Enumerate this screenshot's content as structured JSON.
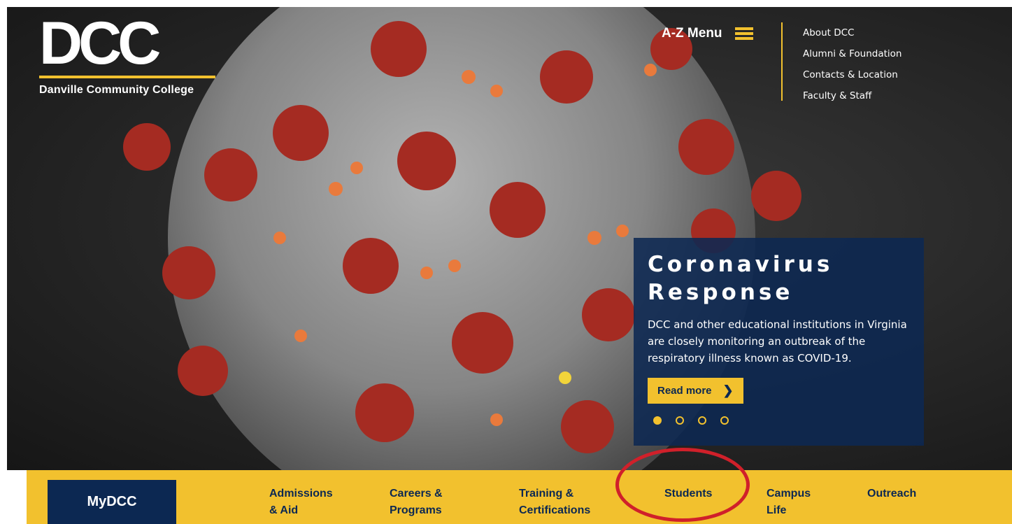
{
  "logo": {
    "mark": "DCC",
    "name": "Danville Community College"
  },
  "header": {
    "az_menu_label": "A-Z Menu",
    "util_links": [
      "About DCC",
      "Alumni & Foundation",
      "Contacts & Location",
      "Faculty & Staff"
    ]
  },
  "promo": {
    "title_line1": "Coronavirus",
    "title_line2": "Response",
    "text": "DCC and other educational institutions in Virginia are closely monitoring an outbreak of the respiratory illness known as COVID-19.",
    "button_label": "Read more",
    "slide_count": 4,
    "active_slide": 1
  },
  "nav": {
    "mydcc_label": "MyDCC",
    "items": [
      {
        "line1": "Admissions",
        "line2": "& Aid"
      },
      {
        "line1": "Careers &",
        "line2": "Programs"
      },
      {
        "line1": "Training &",
        "line2": "Certifications"
      },
      {
        "line1": "Students",
        "line2": ""
      },
      {
        "line1": "Campus",
        "line2": "Life"
      },
      {
        "line1": "Outreach",
        "line2": ""
      }
    ]
  },
  "colors": {
    "gold": "#f2c12e",
    "navy": "#0c2852",
    "annotation_red": "#d0202a"
  },
  "icons": {
    "menu": "hamburger-icon",
    "read_more": "chevron-right-icon"
  }
}
